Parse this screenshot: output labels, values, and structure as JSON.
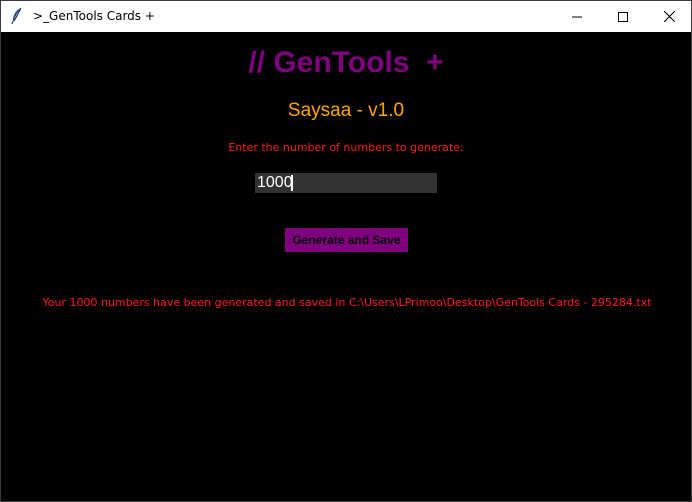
{
  "window": {
    "title": ">_GenTools Cards +"
  },
  "main": {
    "heading": "// GenTools  +",
    "subheading": "Saysaa - v1.0",
    "prompt_label": "Enter the number of numbers to generate:",
    "count_input_value": "1000",
    "generate_button_label": "Generate and Save",
    "result_message": "Your 1000 numbers have been generated and saved in C:\\Users\\LPrimoo\\Desktop\\GenTools Cards - 295284.txt"
  },
  "colors": {
    "background": "#000000",
    "heading": "#800080",
    "subheading": "#ffa500",
    "label": "#ff1a1a",
    "input_bg": "#333333",
    "button_bg": "#800080"
  },
  "icons": {
    "app": "feather-icon",
    "minimize": "minimize-icon",
    "maximize": "maximize-icon",
    "close": "close-icon"
  }
}
